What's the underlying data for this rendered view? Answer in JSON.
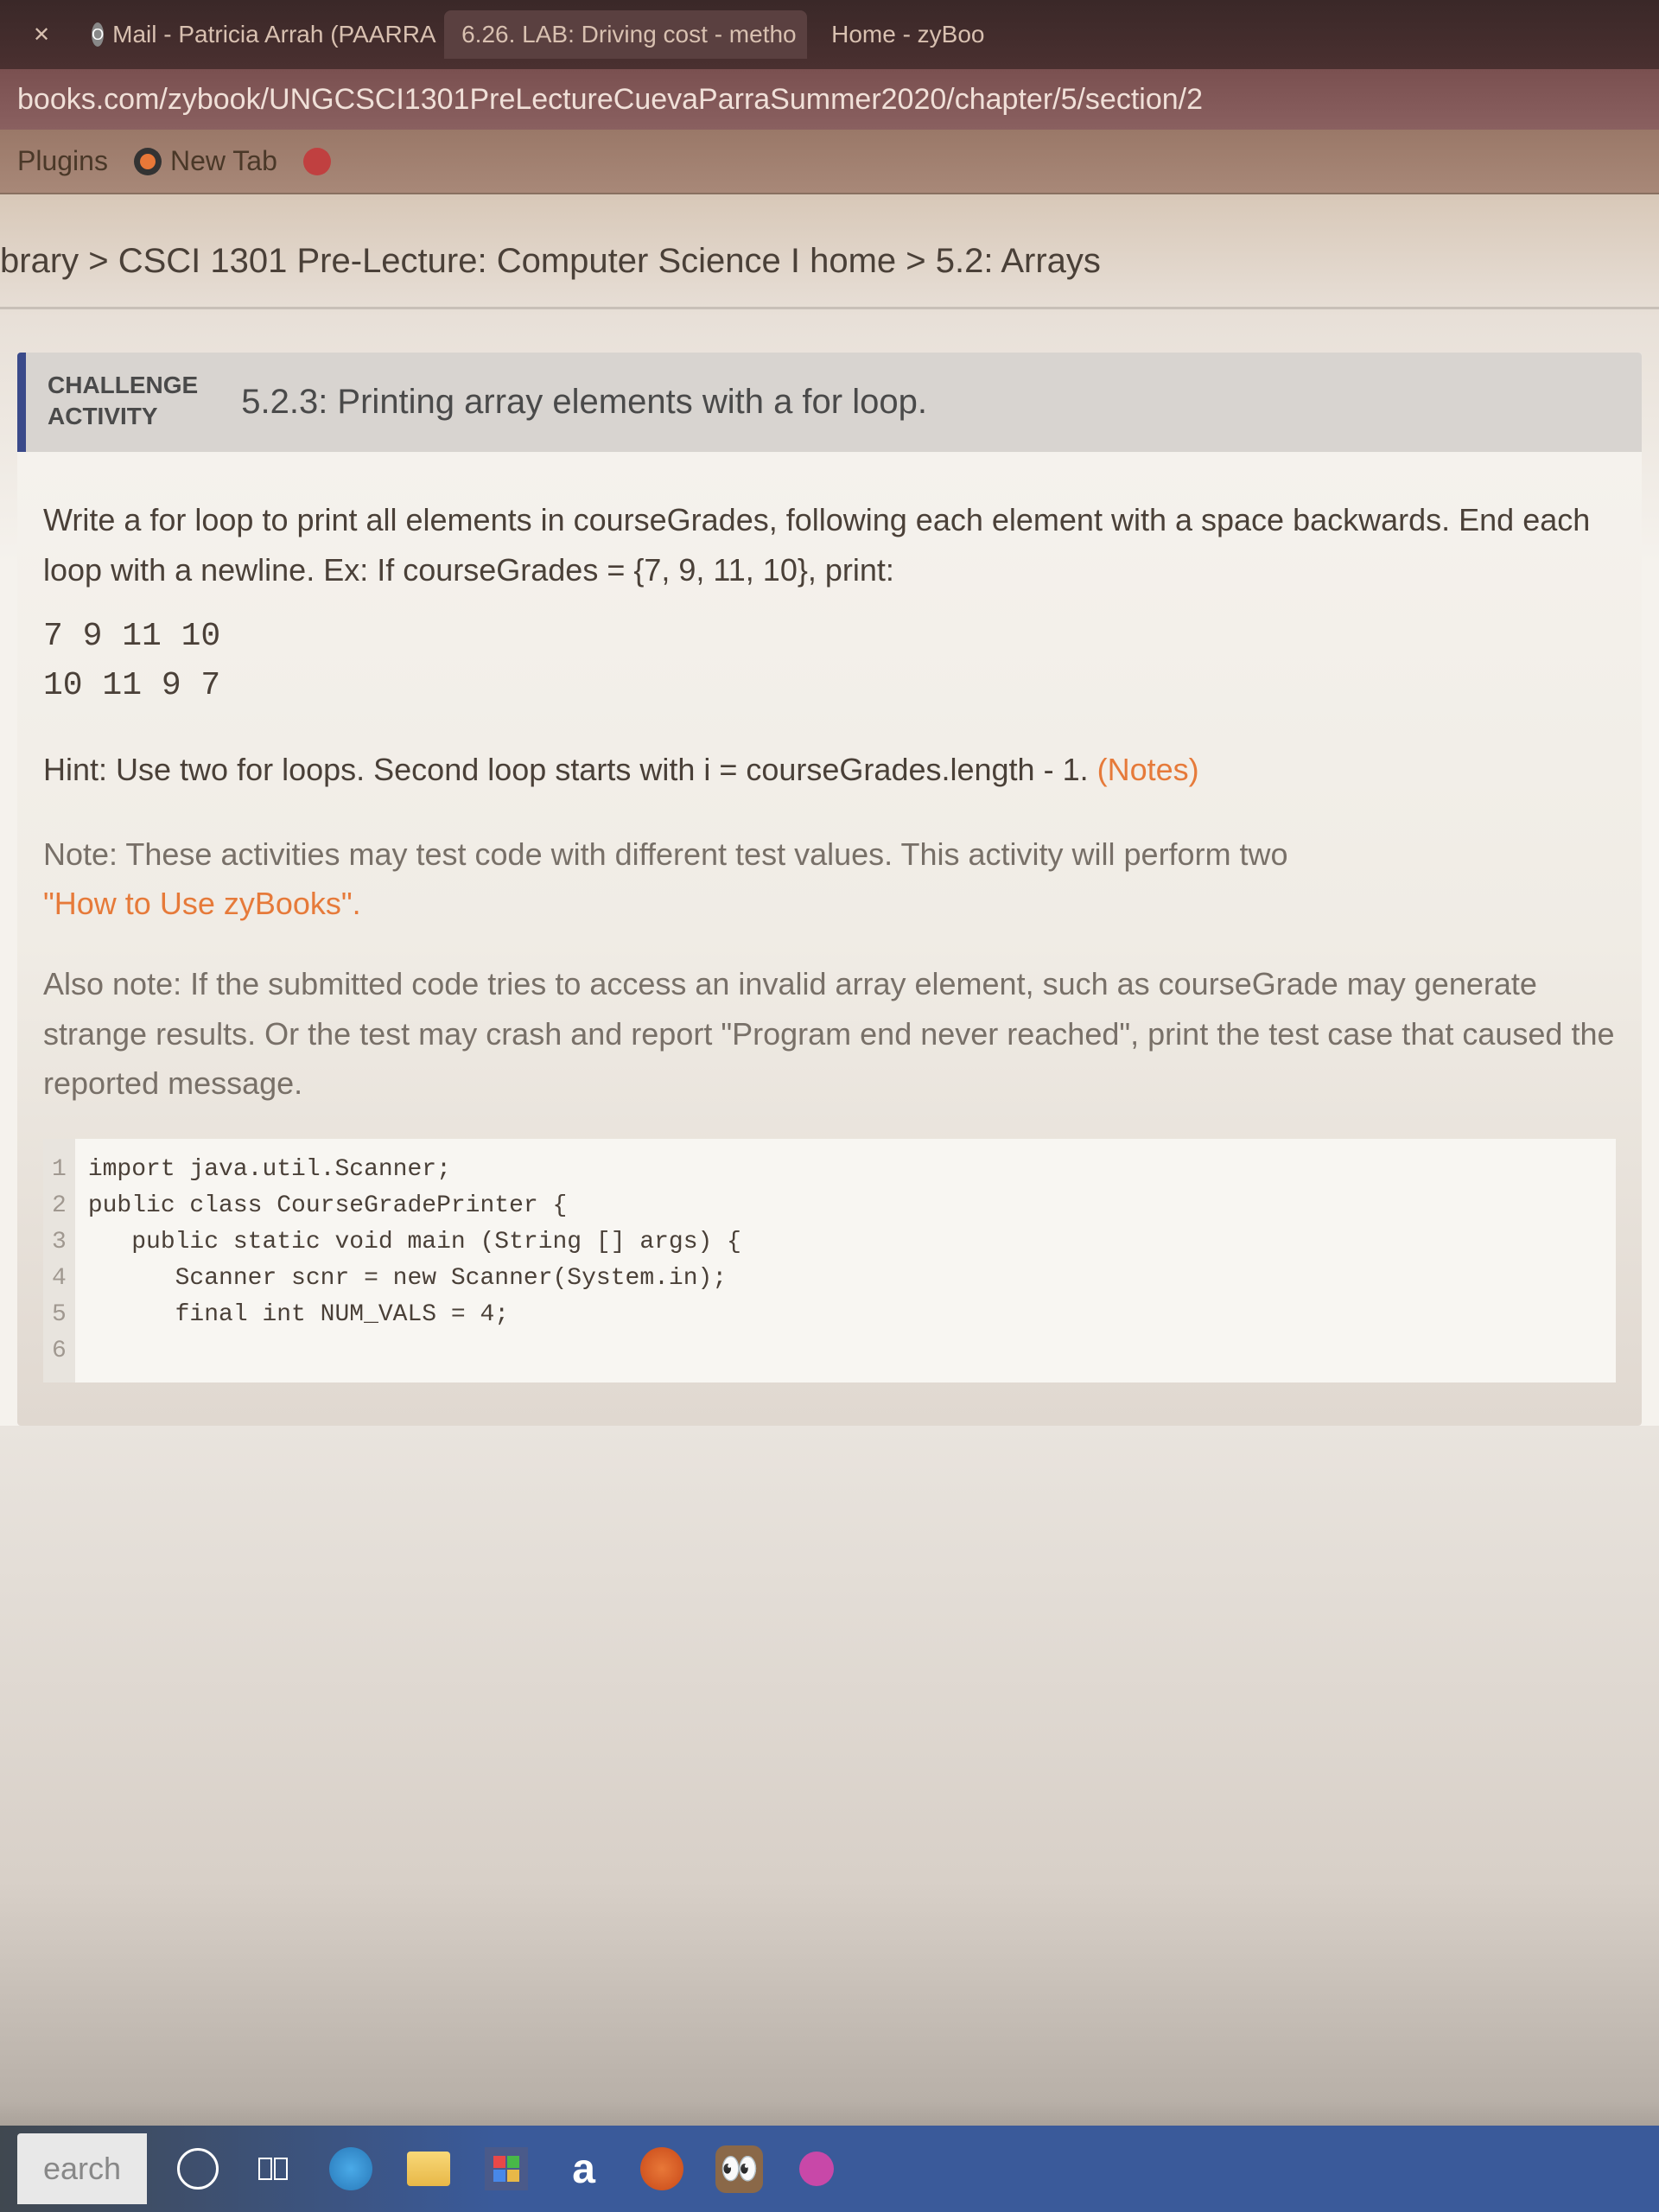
{
  "tabs": [
    {
      "title": "",
      "close": "✕"
    },
    {
      "title": "Mail - Patricia Arrah (PAARRAS",
      "close": "✕"
    },
    {
      "title": "6.26. LAB: Driving cost - metho",
      "close": "✕"
    },
    {
      "title": "Home - zyBoo"
    }
  ],
  "url": "books.com/zybook/UNGCSCI1301PreLectureCuevaParraSummer2020/chapter/5/section/2",
  "bookmarks": {
    "plugins": "Plugins",
    "newtab": "New Tab"
  },
  "breadcrumb": "brary > CSCI 1301 Pre-Lecture: Computer Science I home > 5.2: Arrays",
  "activity": {
    "label_line1": "CHALLENGE",
    "label_line2": "ACTIVITY",
    "title": "5.2.3: Printing array elements with a for loop."
  },
  "body": {
    "instruction": "Write a for loop to print all elements in courseGrades, following each element with a space backwards. End each loop with a newline. Ex: If courseGrades = {7, 9, 11, 10}, print:",
    "example1": "7 9 11 10",
    "example2": "10 11 9 7",
    "hint_prefix": "Hint: Use two for loops. Second loop starts with i = courseGrades.length - 1. ",
    "hint_link": "(Notes)",
    "note1_prefix": "Note: These activities may test code with different test values. This activity will perform two ",
    "howto": "\"How to Use zyBooks\".",
    "note2": "Also note: If the submitted code tries to access an invalid array element, such as courseGrade may generate strange results. Or the test may crash and report \"Program end never reached\", print the test case that caused the reported message."
  },
  "code": {
    "lines": [
      "import java.util.Scanner;",
      "",
      "public class CourseGradePrinter {",
      "   public static void main (String [] args) {",
      "      Scanner scnr = new Scanner(System.in);",
      "      final int NUM_VALS = 4;"
    ],
    "gutter": [
      "1",
      "2",
      "3",
      "4",
      "5",
      "6"
    ]
  },
  "taskbar": {
    "search": "earch",
    "amazon": "a"
  }
}
